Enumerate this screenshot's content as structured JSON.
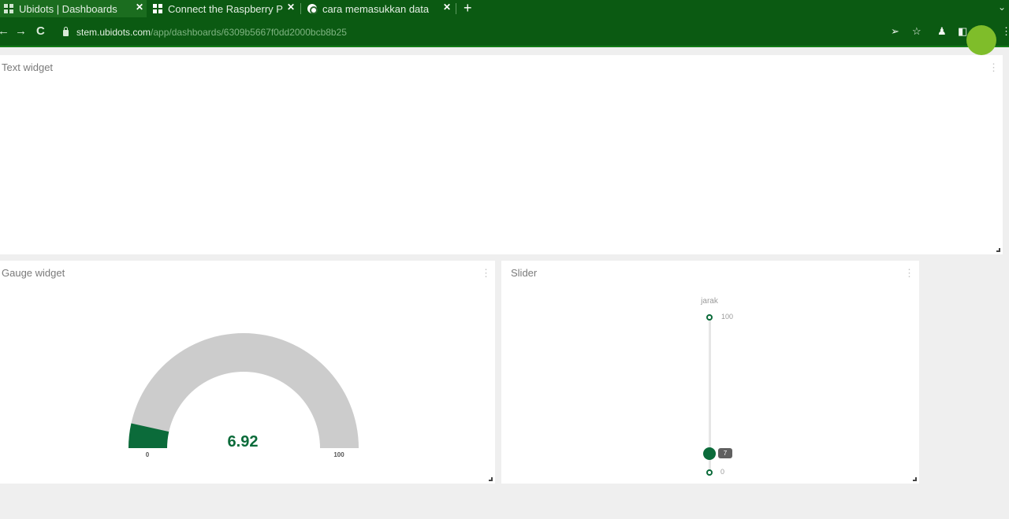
{
  "browser": {
    "tabs": [
      {
        "title": "Ubidots | Dashboards",
        "icon": "ubidots-favicon-icon",
        "active": true
      },
      {
        "title": "Connect the Raspberry P",
        "icon": "windows-favicon-icon",
        "active": false
      },
      {
        "title": "cara memasukkan data",
        "icon": "google-favicon-icon",
        "active": false
      }
    ],
    "close_glyph": "✕",
    "new_tab_glyph": "+",
    "tab_menu_glyph": "⌄",
    "url": {
      "host": "stem.ubidots.com",
      "path": "/app/dashboards/6309b5667f0dd2000bcb8b25"
    },
    "glyphs": {
      "back": "←",
      "forward": "→",
      "reload": "C",
      "share": "➢",
      "bookmark": "☆",
      "extensions": "♟",
      "sidepanel": "◧",
      "profile": "●",
      "menu": "⋮"
    },
    "colors": {
      "chrome": "#0b5a12",
      "active_tab": "#1b6d1f"
    }
  },
  "dashboard": {
    "text_widget": {
      "title": "Text widget",
      "menu_glyph": "⋮"
    },
    "gauge_widget": {
      "title": "Gauge widget",
      "menu_glyph": "⋮",
      "value": 6.92,
      "value_label": "6.92",
      "min_label": "0",
      "max_label": "100",
      "min": 0,
      "max": 100,
      "fill_color": "#0b6b3a",
      "track_color": "#cccccc"
    },
    "slider_widget": {
      "title": "Slider",
      "menu_glyph": "⋮",
      "variable": "jarak",
      "max_label": "100",
      "min_label": "0",
      "value_label": "7",
      "min": 0,
      "max": 100,
      "value": 7,
      "color": "#0b6b3a"
    }
  }
}
